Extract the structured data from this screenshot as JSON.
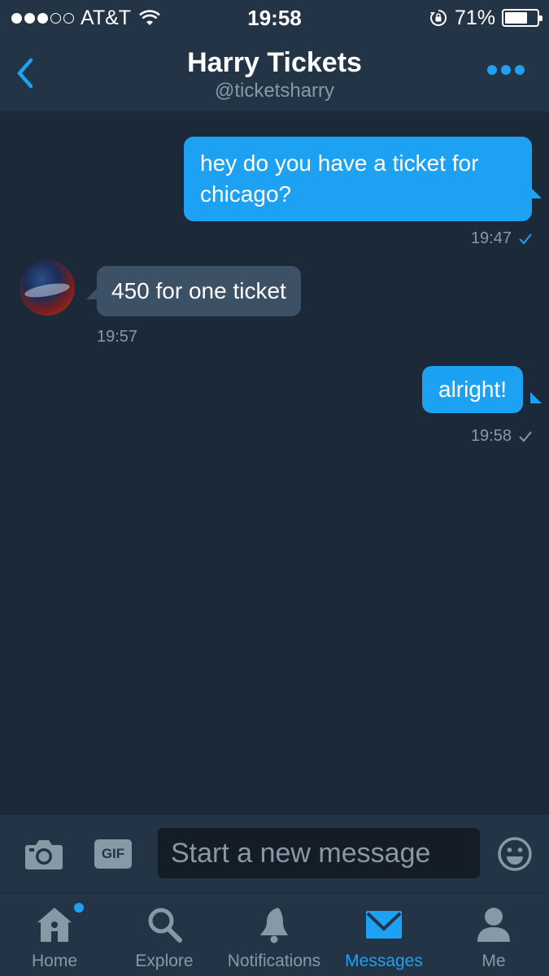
{
  "status_bar": {
    "carrier": "AT&T",
    "time": "19:58",
    "battery_percent": "71%",
    "battery_level": 0.71,
    "signal_bars_filled": 3,
    "signal_bars_total": 5
  },
  "header": {
    "title": "Harry Tickets",
    "handle": "@ticketsharry",
    "back_icon": "chevron-left-icon",
    "more_icon": "more-dots-icon"
  },
  "messages": [
    {
      "direction": "out",
      "text": "hey do you have a ticket for chicago?",
      "time": "19:47",
      "status": "read"
    },
    {
      "direction": "in",
      "text": "450 for one ticket",
      "time": "19:57"
    },
    {
      "direction": "out",
      "text": "alright!",
      "time": "19:58",
      "status": "sent"
    }
  ],
  "composer": {
    "camera_icon": "camera-icon",
    "gif_label": "GIF",
    "placeholder": "Start a new message",
    "emoji_icon": "emoji-icon"
  },
  "tabs": [
    {
      "label": "Home",
      "icon": "home-icon",
      "active": false,
      "has_badge": true
    },
    {
      "label": "Explore",
      "icon": "search-icon",
      "active": false
    },
    {
      "label": "Notifications",
      "icon": "bell-icon",
      "active": false
    },
    {
      "label": "Messages",
      "icon": "envelope-icon",
      "active": true
    },
    {
      "label": "Me",
      "icon": "person-icon",
      "active": false
    }
  ],
  "colors": {
    "background": "#1c2938",
    "bar": "#243447",
    "accent": "#1da1f2",
    "incoming_bubble": "#3d5166",
    "muted_text": "#8899a6"
  }
}
